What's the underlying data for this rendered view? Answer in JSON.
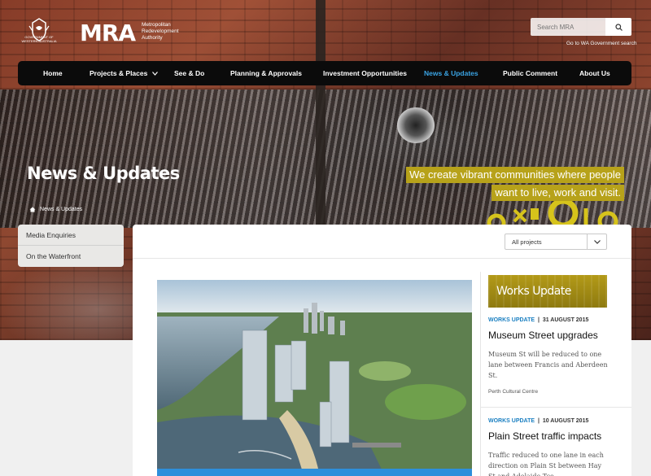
{
  "header": {
    "crest_text": "GOVERNMENT OF WESTERN AUSTRALIA",
    "logo": "MRA",
    "logo_sub": "Metropolitan Redevelopment Authority",
    "search_placeholder": "Search MRA",
    "gov_link": "Go to WA Government search"
  },
  "nav": {
    "items": [
      {
        "label": "Home"
      },
      {
        "label": "Projects & Places"
      },
      {
        "label": "See & Do"
      },
      {
        "label": "Planning & Approvals"
      },
      {
        "label": "Investment Opportunities"
      },
      {
        "label": "News & Updates"
      },
      {
        "label": "Public Comment"
      },
      {
        "label": "About Us"
      }
    ],
    "active": "News & Updates"
  },
  "hero": {
    "title": "News & Updates",
    "tagline_line1": "We create vibrant communities where people",
    "tagline_line2": "want to live, work and visit.",
    "accent_color": "#b7a21a"
  },
  "breadcrumb": {
    "current": "News & Updates"
  },
  "side_menu": {
    "items": [
      {
        "label": "Media Enquiries"
      },
      {
        "label": "On the Waterfront"
      }
    ]
  },
  "filter": {
    "selected": "All projects"
  },
  "works_banner": {
    "title": "Works Update"
  },
  "news": [
    {
      "category": "WORKS UPDATE",
      "date": "31 AUGUST 2015",
      "title": "Museum Street upgrades",
      "body": "Museum St will be reduced to one lane between Francis and Aberdeen St.",
      "location": "Perth Cultural Centre"
    },
    {
      "category": "WORKS UPDATE",
      "date": "10 AUGUST 2015",
      "title": "Plain Street traffic impacts",
      "body": "Traffic reduced to one lane in each direction on Plain St between Hay St and Adelaide Tce.",
      "location": ""
    }
  ],
  "colors": {
    "nav_bg": "#0b0b0b",
    "nav_active": "#3aa3e3",
    "category": "#1a7fc1",
    "feature_strip": "#2e8fdb"
  }
}
